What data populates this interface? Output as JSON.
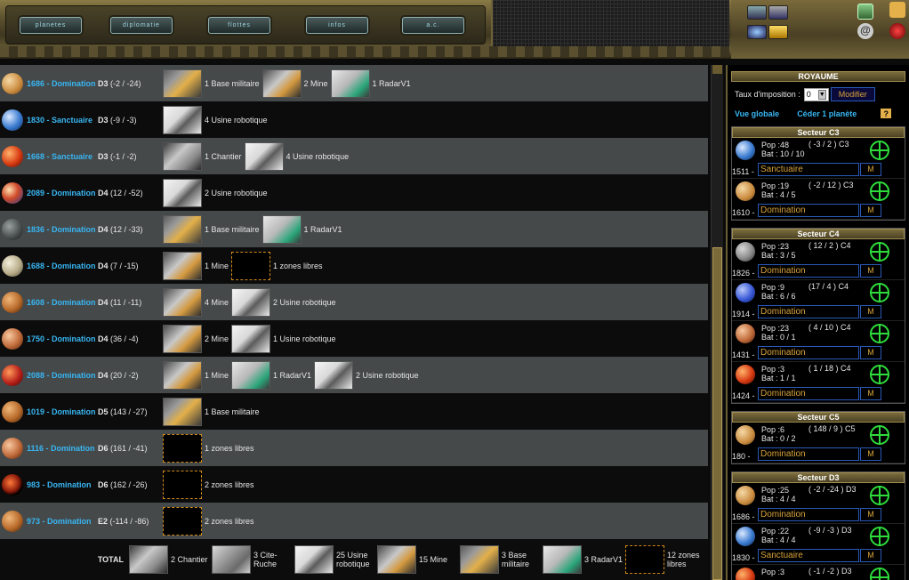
{
  "nav": {
    "buttons": [
      "planetes",
      "diplomatie",
      "flottes",
      "infos",
      "a.c."
    ]
  },
  "list": {
    "rows": [
      {
        "name": "1686 - Domination",
        "sector": "D3",
        "coords": "(-2 / -24)",
        "planet": "c1",
        "buildings": [
          {
            "type": "base",
            "label": "1 Base militaire"
          },
          {
            "type": "mine",
            "label": "2 Mine"
          },
          {
            "type": "radar",
            "label": "1 RadarV1"
          }
        ]
      },
      {
        "name": "1830 - Sanctuaire",
        "sector": "D3",
        "coords": "(-9 / -3)",
        "planet": "c2",
        "buildings": [
          {
            "type": "usine",
            "label": "4 Usine robotique"
          }
        ]
      },
      {
        "name": "1668 - Sanctuaire",
        "sector": "D3",
        "coords": "(-1 / -2)",
        "planet": "c3",
        "buildings": [
          {
            "type": "chantier",
            "label": "1 Chantier"
          },
          {
            "type": "usine",
            "label": "4 Usine robotique"
          }
        ]
      },
      {
        "name": "2089 - Domination",
        "sector": "D4",
        "coords": "(12 / -52)",
        "planet": "c4",
        "buildings": [
          {
            "type": "usine",
            "label": "2 Usine robotique"
          }
        ]
      },
      {
        "name": "1836 - Domination",
        "sector": "D4",
        "coords": "(12 / -33)",
        "planet": "c5",
        "buildings": [
          {
            "type": "base",
            "label": "1 Base militaire"
          },
          {
            "type": "radar",
            "label": "1 RadarV1"
          }
        ]
      },
      {
        "name": "1688 - Domination",
        "sector": "D4",
        "coords": "(7 / -15)",
        "planet": "c6",
        "buildings": [
          {
            "type": "mine",
            "label": "1 Mine"
          },
          {
            "type": "free",
            "label": "1 zones libres"
          }
        ]
      },
      {
        "name": "1608 - Domination",
        "sector": "D4",
        "coords": "(11 / -11)",
        "planet": "c7",
        "buildings": [
          {
            "type": "mine",
            "label": "4 Mine"
          },
          {
            "type": "usine",
            "label": "2 Usine robotique"
          }
        ]
      },
      {
        "name": "1750 - Domination",
        "sector": "D4",
        "coords": "(36 / -4)",
        "planet": "c8",
        "buildings": [
          {
            "type": "mine",
            "label": "2 Mine"
          },
          {
            "type": "usine",
            "label": "1 Usine robotique"
          }
        ]
      },
      {
        "name": "2088 - Domination",
        "sector": "D4",
        "coords": "(20 / -2)",
        "planet": "c9",
        "buildings": [
          {
            "type": "mine",
            "label": "1 Mine"
          },
          {
            "type": "radar",
            "label": "1 RadarV1"
          },
          {
            "type": "usine",
            "label": "2 Usine robotique"
          }
        ]
      },
      {
        "name": "1019 - Domination",
        "sector": "D5",
        "coords": "(143 / -27)",
        "planet": "c7",
        "buildings": [
          {
            "type": "base",
            "label": "1 Base militaire"
          }
        ]
      },
      {
        "name": "1116 - Domination",
        "sector": "D6",
        "coords": "(161 / -41)",
        "planet": "c8",
        "buildings": [
          {
            "type": "free",
            "label": "1 zones libres"
          }
        ]
      },
      {
        "name": "983 - Domination",
        "sector": "D6",
        "coords": "(162 / -26)",
        "planet": "c10",
        "buildings": [
          {
            "type": "free",
            "label": "2 zones libres"
          }
        ]
      },
      {
        "name": "973 - Domination",
        "sector": "E2",
        "coords": "(-114 / -86)",
        "planet": "c7",
        "buildings": [
          {
            "type": "free",
            "label": "2 zones libres"
          }
        ]
      }
    ],
    "total": {
      "label": "TOTAL",
      "items": [
        {
          "type": "chantier",
          "label": "2 Chantier"
        },
        {
          "type": "cite",
          "label": "3 Cite-Ruche"
        },
        {
          "type": "usine",
          "label": "25 Usine robotique"
        },
        {
          "type": "mine",
          "label": "15 Mine"
        },
        {
          "type": "base",
          "label": "3 Base militaire"
        },
        {
          "type": "radar",
          "label": "3 RadarV1"
        },
        {
          "type": "free",
          "label": "12 zones libres"
        }
      ]
    }
  },
  "royaume": {
    "title": "ROYAUME",
    "taux_label": "Taux d'imposition :",
    "taux_value": "0",
    "modifier_label": "Modifier",
    "vue_globale": "Vue globale",
    "ceder": "Céder 1 planète",
    "help": "?"
  },
  "sectors": [
    {
      "title": "Secteur C3",
      "planets": [
        {
          "pop": "Pop :48",
          "bat": "Bat : 10 / 10",
          "coord": "( -3 / 2 ) C3",
          "num": "1511 -",
          "name": "Sanctuaire",
          "planet": "c2"
        },
        {
          "pop": "Pop :19",
          "bat": "Bat : 4 / 5",
          "coord": "( -2 / 12 ) C3",
          "num": "1610 -",
          "name": "Domination",
          "planet": "c1"
        }
      ]
    },
    {
      "title": "Secteur C4",
      "planets": [
        {
          "pop": "Pop :23",
          "bat": "Bat : 3 / 5",
          "coord": "( 12 / 2 ) C4",
          "num": "1826 -",
          "name": "Domination",
          "planet": "c12"
        },
        {
          "pop": "Pop :9",
          "bat": "Bat : 6 / 6",
          "coord": "(17 / 4 ) C4",
          "num": "1914 -",
          "name": "Domination",
          "planet": "c11"
        },
        {
          "pop": "Pop :23",
          "bat": "Bat : 0 / 1",
          "coord": "( 4 / 10 ) C4",
          "num": "1431 -",
          "name": "Domination",
          "planet": "c8"
        },
        {
          "pop": "Pop :3",
          "bat": "Bat : 1 / 1",
          "coord": "( 1 / 18 ) C4",
          "num": "1424 -",
          "name": "Domination",
          "planet": "c3"
        }
      ]
    },
    {
      "title": "Secteur C5",
      "planets": [
        {
          "pop": "Pop :6",
          "bat": "Bat : 0 / 2",
          "coord": "( 148 / 9 ) C5",
          "num": "180 -",
          "name": "Domination",
          "planet": "c1"
        }
      ]
    },
    {
      "title": "Secteur D3",
      "planets": [
        {
          "pop": "Pop :25",
          "bat": "Bat : 4 / 4",
          "coord": "( -2 / -24 ) D3",
          "num": "1686 -",
          "name": "Domination",
          "planet": "c1"
        },
        {
          "pop": "Pop :22",
          "bat": "Bat : 4 / 4",
          "coord": "( -9 / -3 ) D3",
          "num": "1830 -",
          "name": "Sanctuaire",
          "planet": "c2"
        },
        {
          "pop": "Pop :3",
          "bat": "",
          "coord": "( -1 / -2 ) D3",
          "num": "",
          "name": "",
          "planet": "c3"
        }
      ]
    }
  ],
  "m_label": "M"
}
